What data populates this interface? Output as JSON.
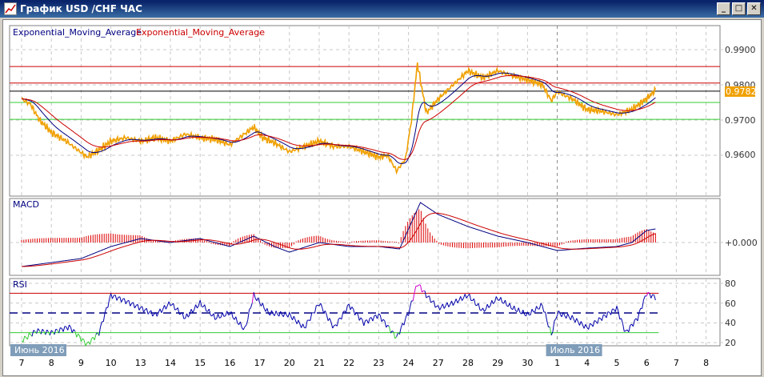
{
  "window": {
    "title": "График USD /CHF  ЧАС",
    "minimize": "_",
    "maximize": "□",
    "close": "✕"
  },
  "main_panel": {
    "legend": [
      {
        "text": "Exponential_Moving_Average",
        "color": "#000080"
      },
      {
        "text": "Exponential_Moving_Average",
        "color": "#cc0000"
      }
    ],
    "price_ticks": [
      "0.9900",
      "0.9800",
      "0.9700",
      "0.9600"
    ],
    "current_price": "0.9782",
    "levels": [
      {
        "value": 0.9852,
        "color": "#cc0000"
      },
      {
        "value": 0.9805,
        "color": "#cc0000"
      },
      {
        "value": 0.9782,
        "color": "#000000"
      },
      {
        "value": 0.975,
        "color": "#33cc33"
      },
      {
        "value": 0.9702,
        "color": "#33cc33"
      }
    ]
  },
  "macd_panel": {
    "label": "MACD",
    "zero_label": "+0.000"
  },
  "rsi_panel": {
    "label": "RSI",
    "ticks": [
      "80",
      "60",
      "40",
      "20"
    ],
    "levels": [
      {
        "value": 70,
        "color": "#cc0000"
      },
      {
        "value": 50,
        "color": "#000080"
      },
      {
        "value": 30,
        "color": "#33cc33"
      }
    ]
  },
  "x_axis": {
    "labels": [
      "7",
      "8",
      "9",
      "10",
      "13",
      "14",
      "15",
      "16",
      "17",
      "20",
      "21",
      "22",
      "23",
      "24",
      "27",
      "28",
      "29",
      "30",
      "1",
      "4",
      "5",
      "6",
      "7",
      "8"
    ],
    "month_tags": [
      {
        "text": "Июнь 2016",
        "index": 0
      },
      {
        "text": "Июль 2016",
        "index": 18
      }
    ]
  },
  "chart_data": {
    "type": "line",
    "title": "USD/CHF H1",
    "price": [
      [
        0,
        0.976
      ],
      [
        0.3,
        0.9745
      ],
      [
        0.6,
        0.97
      ],
      [
        1,
        0.9665
      ],
      [
        1.5,
        0.964
      ],
      [
        2.2,
        0.9595
      ],
      [
        2.6,
        0.9615
      ],
      [
        3,
        0.964
      ],
      [
        3.5,
        0.965
      ],
      [
        4,
        0.964
      ],
      [
        4.5,
        0.965
      ],
      [
        5,
        0.964
      ],
      [
        5.5,
        0.966
      ],
      [
        6,
        0.965
      ],
      [
        6.5,
        0.9645
      ],
      [
        7,
        0.963
      ],
      [
        7.8,
        0.968
      ],
      [
        8.1,
        0.965
      ],
      [
        8.5,
        0.9635
      ],
      [
        9,
        0.961
      ],
      [
        9.5,
        0.9625
      ],
      [
        10,
        0.964
      ],
      [
        10.5,
        0.9625
      ],
      [
        11,
        0.9625
      ],
      [
        11.5,
        0.961
      ],
      [
        12,
        0.9595
      ],
      [
        12.3,
        0.96
      ],
      [
        12.6,
        0.9555
      ],
      [
        12.9,
        0.959
      ],
      [
        13.1,
        0.97
      ],
      [
        13.3,
        0.986
      ],
      [
        13.6,
        0.972
      ],
      [
        14,
        0.976
      ],
      [
        14.5,
        0.98
      ],
      [
        15,
        0.984
      ],
      [
        15.5,
        0.982
      ],
      [
        16,
        0.984
      ],
      [
        16.5,
        0.9825
      ],
      [
        17,
        0.9815
      ],
      [
        17.5,
        0.98
      ],
      [
        17.8,
        0.9755
      ],
      [
        18,
        0.978
      ],
      [
        18.5,
        0.976
      ],
      [
        19,
        0.973
      ],
      [
        19.5,
        0.9725
      ],
      [
        20,
        0.9715
      ],
      [
        20.5,
        0.973
      ],
      [
        21,
        0.976
      ],
      [
        21.3,
        0.9785
      ]
    ],
    "macd": [
      [
        0,
        -0.003
      ],
      [
        1,
        -0.0025
      ],
      [
        2,
        -0.002
      ],
      [
        3,
        -0.0005
      ],
      [
        4,
        0.0005
      ],
      [
        5,
        0
      ],
      [
        6,
        0.0005
      ],
      [
        7,
        -0.0005
      ],
      [
        7.8,
        0.0008
      ],
      [
        8.5,
        -0.0005
      ],
      [
        9,
        -0.0012
      ],
      [
        10,
        0
      ],
      [
        11,
        -0.0005
      ],
      [
        12,
        -0.0005
      ],
      [
        12.7,
        -0.0008
      ],
      [
        13.4,
        0.005
      ],
      [
        14,
        0.0035
      ],
      [
        15,
        0.002
      ],
      [
        16,
        0.0008
      ],
      [
        17,
        0
      ],
      [
        18,
        -0.001
      ],
      [
        19,
        -0.0007
      ],
      [
        20,
        -0.0005
      ],
      [
        20.5,
        0
      ],
      [
        21,
        0.0015
      ],
      [
        21.3,
        0.0017
      ]
    ],
    "rsi": [
      [
        0,
        22
      ],
      [
        0.5,
        32
      ],
      [
        1,
        30
      ],
      [
        1.6,
        36
      ],
      [
        2.2,
        18
      ],
      [
        2.6,
        30
      ],
      [
        3,
        68
      ],
      [
        3.5,
        62
      ],
      [
        4,
        55
      ],
      [
        4.5,
        48
      ],
      [
        5,
        60
      ],
      [
        5.5,
        45
      ],
      [
        6,
        60
      ],
      [
        6.5,
        45
      ],
      [
        7,
        50
      ],
      [
        7.5,
        33
      ],
      [
        7.8,
        68
      ],
      [
        8.3,
        50
      ],
      [
        9,
        48
      ],
      [
        9.5,
        35
      ],
      [
        10,
        60
      ],
      [
        10.5,
        35
      ],
      [
        11,
        58
      ],
      [
        11.5,
        40
      ],
      [
        12,
        48
      ],
      [
        12.6,
        25
      ],
      [
        13,
        50
      ],
      [
        13.3,
        80
      ],
      [
        13.6,
        68
      ],
      [
        14,
        55
      ],
      [
        14.5,
        60
      ],
      [
        15,
        68
      ],
      [
        15.5,
        52
      ],
      [
        16,
        65
      ],
      [
        16.5,
        55
      ],
      [
        17,
        48
      ],
      [
        17.5,
        58
      ],
      [
        17.8,
        28
      ],
      [
        18,
        50
      ],
      [
        18.5,
        45
      ],
      [
        19,
        35
      ],
      [
        19.5,
        45
      ],
      [
        20,
        55
      ],
      [
        20.3,
        30
      ],
      [
        20.7,
        45
      ],
      [
        21,
        70
      ],
      [
        21.3,
        66
      ]
    ],
    "ylim_price": [
      0.953,
      0.992
    ],
    "ylim_rsi": [
      15,
      85
    ]
  }
}
